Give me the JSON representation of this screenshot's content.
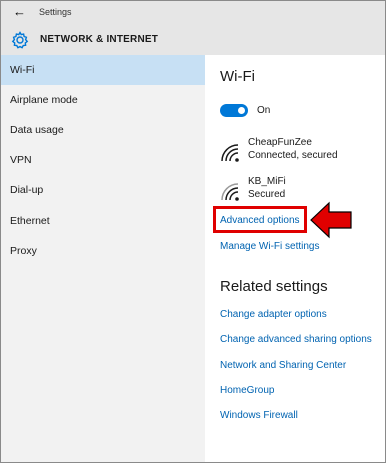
{
  "window": {
    "title": "Settings"
  },
  "header": {
    "section_title": "NETWORK & INTERNET"
  },
  "sidebar": {
    "items": [
      {
        "label": "Wi-Fi",
        "active": true
      },
      {
        "label": "Airplane mode"
      },
      {
        "label": "Data usage"
      },
      {
        "label": "VPN"
      },
      {
        "label": "Dial-up"
      },
      {
        "label": "Ethernet"
      },
      {
        "label": "Proxy"
      }
    ]
  },
  "main": {
    "heading": "Wi-Fi",
    "toggle": {
      "label": "On",
      "state": "on"
    },
    "networks": [
      {
        "name": "CheapFunZee",
        "status": "Connected, secured",
        "icon": "wifi-signal-icon"
      },
      {
        "name": "KB_MiFi",
        "status": "Secured",
        "icon": "wifi-signal-icon"
      }
    ],
    "advanced_options": "Advanced options",
    "manage_wifi": "Manage Wi-Fi settings",
    "related": {
      "heading": "Related settings",
      "links": [
        "Change adapter options",
        "Change advanced sharing options",
        "Network and Sharing Center",
        "HomeGroup",
        "Windows Firewall"
      ]
    }
  },
  "colors": {
    "accent": "#0078d7",
    "link": "#0063b1",
    "active_nav": "#c7e0f4",
    "highlight": "#e00000"
  }
}
